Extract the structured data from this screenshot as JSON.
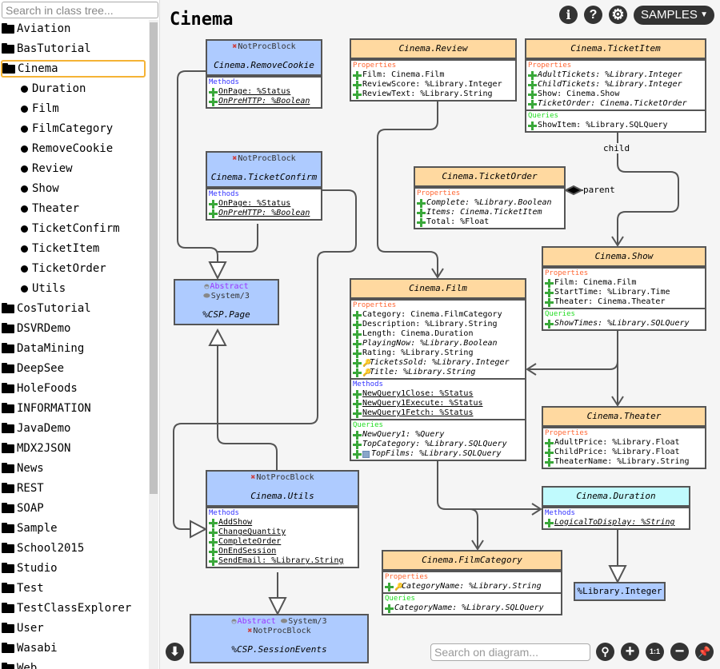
{
  "sidebar": {
    "search_placeholder": "Search in class tree...",
    "items": [
      {
        "label": "Aviation",
        "type": "package"
      },
      {
        "label": "BasTutorial",
        "type": "package"
      },
      {
        "label": "Cinema",
        "type": "package",
        "selected": true
      },
      {
        "label": "Duration",
        "type": "class"
      },
      {
        "label": "Film",
        "type": "class"
      },
      {
        "label": "FilmCategory",
        "type": "class"
      },
      {
        "label": "RemoveCookie",
        "type": "class"
      },
      {
        "label": "Review",
        "type": "class"
      },
      {
        "label": "Show",
        "type": "class"
      },
      {
        "label": "Theater",
        "type": "class"
      },
      {
        "label": "TicketConfirm",
        "type": "class"
      },
      {
        "label": "TicketItem",
        "type": "class"
      },
      {
        "label": "TicketOrder",
        "type": "class"
      },
      {
        "label": "Utils",
        "type": "class"
      },
      {
        "label": "CosTutorial",
        "type": "package"
      },
      {
        "label": "DSVRDemo",
        "type": "package"
      },
      {
        "label": "DataMining",
        "type": "package"
      },
      {
        "label": "DeepSee",
        "type": "package"
      },
      {
        "label": "HoleFoods",
        "type": "package"
      },
      {
        "label": "INFORMATION",
        "type": "package"
      },
      {
        "label": "JavaDemo",
        "type": "package"
      },
      {
        "label": "MDX2JSON",
        "type": "package"
      },
      {
        "label": "News",
        "type": "package"
      },
      {
        "label": "REST",
        "type": "package"
      },
      {
        "label": "SOAP",
        "type": "package"
      },
      {
        "label": "Sample",
        "type": "package"
      },
      {
        "label": "School2015",
        "type": "package"
      },
      {
        "label": "Studio",
        "type": "package"
      },
      {
        "label": "Test",
        "type": "package"
      },
      {
        "label": "TestClassExplorer",
        "type": "package"
      },
      {
        "label": "User",
        "type": "package"
      },
      {
        "label": "Wasabi",
        "type": "package"
      },
      {
        "label": "Web",
        "type": "package"
      }
    ]
  },
  "header": {
    "title": "Cinema",
    "info_icon": "info-icon",
    "help_icon": "help-icon",
    "settings_icon": "gear-icon",
    "namespace": "SAMPLES"
  },
  "colors": {
    "persistent": "#ffd9a0",
    "csp": "#aecbff",
    "datatype": "#c0fafd",
    "properties": "#ff6633",
    "methods": "#3333ff",
    "queries": "#22dd22"
  },
  "classes": [
    {
      "id": "removecookie",
      "name": "Cinema.RemoveCookie",
      "color": "csp",
      "stereotypes": [
        [
          "NotProcBlock"
        ]
      ],
      "sections": [
        {
          "title": "Methods",
          "kind": "methods",
          "items": [
            {
              "t": "OnPage: %Status",
              "u": 1
            },
            {
              "t": "OnPreHTTP: %Boolean",
              "u": 1,
              "i": 1
            }
          ]
        }
      ]
    },
    {
      "id": "ticketconfirm",
      "name": "Cinema.TicketConfirm",
      "color": "csp",
      "stereotypes": [
        [
          "NotProcBlock"
        ]
      ],
      "sections": [
        {
          "title": "Methods",
          "kind": "methods",
          "items": [
            {
              "t": "OnPage: %Status",
              "u": 1
            },
            {
              "t": "OnPreHTTP: %Boolean",
              "u": 1,
              "i": 1
            }
          ]
        }
      ]
    },
    {
      "id": "csppage",
      "name": "%CSP.Page",
      "color": "csp",
      "stereotypes": [
        [
          "Abstract"
        ],
        [
          "System/3"
        ]
      ],
      "sections": []
    },
    {
      "id": "review",
      "name": "Cinema.Review",
      "color": "persistent",
      "stereotypes": [],
      "sections": [
        {
          "title": "Properties",
          "kind": "properties",
          "items": [
            {
              "t": "Film: Cinema.Film"
            },
            {
              "t": "ReviewScore: %Library.Integer"
            },
            {
              "t": "ReviewText: %Library.String"
            }
          ]
        }
      ]
    },
    {
      "id": "ticketitem",
      "name": "Cinema.TicketItem",
      "color": "persistent",
      "stereotypes": [],
      "sections": [
        {
          "title": "Properties",
          "kind": "properties",
          "items": [
            {
              "t": "AdultTickets: %Library.Integer",
              "i": 1
            },
            {
              "t": "ChildTickets: %Library.Integer",
              "i": 1
            },
            {
              "t": "Show: Cinema.Show"
            },
            {
              "t": "TicketOrder: Cinema.TicketOrder",
              "i": 1
            }
          ]
        },
        {
          "title": "Queries",
          "kind": "queries",
          "items": [
            {
              "t": "ShowItem: %Library.SQLQuery"
            }
          ]
        }
      ]
    },
    {
      "id": "ticketorder",
      "name": "Cinema.TicketOrder",
      "color": "persistent",
      "stereotypes": [],
      "sections": [
        {
          "title": "Properties",
          "kind": "properties",
          "items": [
            {
              "t": "Complete: %Library.Boolean",
              "i": 1
            },
            {
              "t": "Items: Cinema.TicketItem",
              "i": 1
            },
            {
              "t": "Total: %Float"
            }
          ]
        }
      ]
    },
    {
      "id": "show",
      "name": "Cinema.Show",
      "color": "persistent",
      "stereotypes": [],
      "sections": [
        {
          "title": "Properties",
          "kind": "properties",
          "items": [
            {
              "t": "Film: Cinema.Film"
            },
            {
              "t": "StartTime: %Library.Time"
            },
            {
              "t": "Theater: Cinema.Theater"
            }
          ]
        },
        {
          "title": "Queries",
          "kind": "queries",
          "items": [
            {
              "t": "ShowTimes: %Library.SQLQuery",
              "i": 1
            }
          ]
        }
      ]
    },
    {
      "id": "film",
      "name": "Cinema.Film",
      "color": "persistent",
      "stereotypes": [],
      "sections": [
        {
          "title": "Properties",
          "kind": "properties",
          "items": [
            {
              "t": "Category: Cinema.FilmCategory"
            },
            {
              "t": "Description: %Library.String"
            },
            {
              "t": "Length: Cinema.Duration"
            },
            {
              "t": "PlayingNow: %Library.Boolean",
              "i": 1
            },
            {
              "t": "Rating: %Library.String"
            },
            {
              "t": "TicketsSold: %Library.Integer",
              "i": 1,
              "key": 1
            },
            {
              "t": "Title: %Library.String",
              "i": 1,
              "key": 1
            }
          ]
        },
        {
          "title": "Methods",
          "kind": "methods",
          "items": [
            {
              "t": "NewQuery1Close: %Status",
              "u": 1
            },
            {
              "t": "NewQuery1Execute: %Status",
              "u": 1
            },
            {
              "t": "NewQuery1Fetch: %Status",
              "u": 1
            }
          ]
        },
        {
          "title": "Queries",
          "kind": "queries",
          "items": [
            {
              "t": "NewQuery1: %Query",
              "i": 1
            },
            {
              "t": "TopCategory: %Library.SQLQuery",
              "i": 1
            },
            {
              "t": "TopFilms: %Library.SQLQuery",
              "i": 1,
              "tbl": 1
            }
          ]
        }
      ]
    },
    {
      "id": "theater",
      "name": "Cinema.Theater",
      "color": "persistent",
      "stereotypes": [],
      "sections": [
        {
          "title": "Properties",
          "kind": "properties",
          "items": [
            {
              "t": "AdultPrice: %Library.Float"
            },
            {
              "t": "ChildPrice: %Library.Float"
            },
            {
              "t": "TheaterName: %Library.String"
            }
          ]
        }
      ]
    },
    {
      "id": "duration",
      "name": "Cinema.Duration",
      "color": "datatype",
      "stereotypes": [],
      "sections": [
        {
          "title": "Methods",
          "kind": "methods",
          "items": [
            {
              "t": "LogicalToDisplay: %String",
              "u": 1,
              "i": 1
            }
          ]
        }
      ]
    },
    {
      "id": "filmcategory",
      "name": "Cinema.FilmCategory",
      "color": "persistent",
      "stereotypes": [],
      "sections": [
        {
          "title": "Properties",
          "kind": "properties",
          "items": [
            {
              "t": "CategoryName: %Library.String",
              "i": 1,
              "key": 1
            }
          ]
        },
        {
          "title": "Queries",
          "kind": "queries",
          "items": [
            {
              "t": "CategoryName: %Library.SQLQuery",
              "i": 1
            }
          ]
        }
      ]
    },
    {
      "id": "utils",
      "name": "Cinema.Utils",
      "color": "csp",
      "stereotypes": [
        [
          "NotProcBlock"
        ]
      ],
      "sections": [
        {
          "title": "Methods",
          "kind": "methods",
          "items": [
            {
              "t": "AddShow",
              "u": 1
            },
            {
              "t": "ChangeQuantity",
              "u": 1
            },
            {
              "t": "CompleteOrder",
              "u": 1
            },
            {
              "t": "OnEndSession",
              "u": 1
            },
            {
              "t": "SendEmail: %Library.String",
              "u": 1
            }
          ]
        }
      ]
    },
    {
      "id": "sessionevents",
      "name": "%CSP.SessionEvents",
      "color": "csp",
      "stereotypes": [
        [
          "Abstract",
          "System/3"
        ],
        [
          "NotProcBlock"
        ]
      ],
      "sections": []
    }
  ],
  "library_integer": "%Library.Integer",
  "link_labels": {
    "child": "child",
    "parent": "parent"
  },
  "footer": {
    "search_placeholder": "Search on diagram...",
    "zoom_reset": "1:1"
  }
}
